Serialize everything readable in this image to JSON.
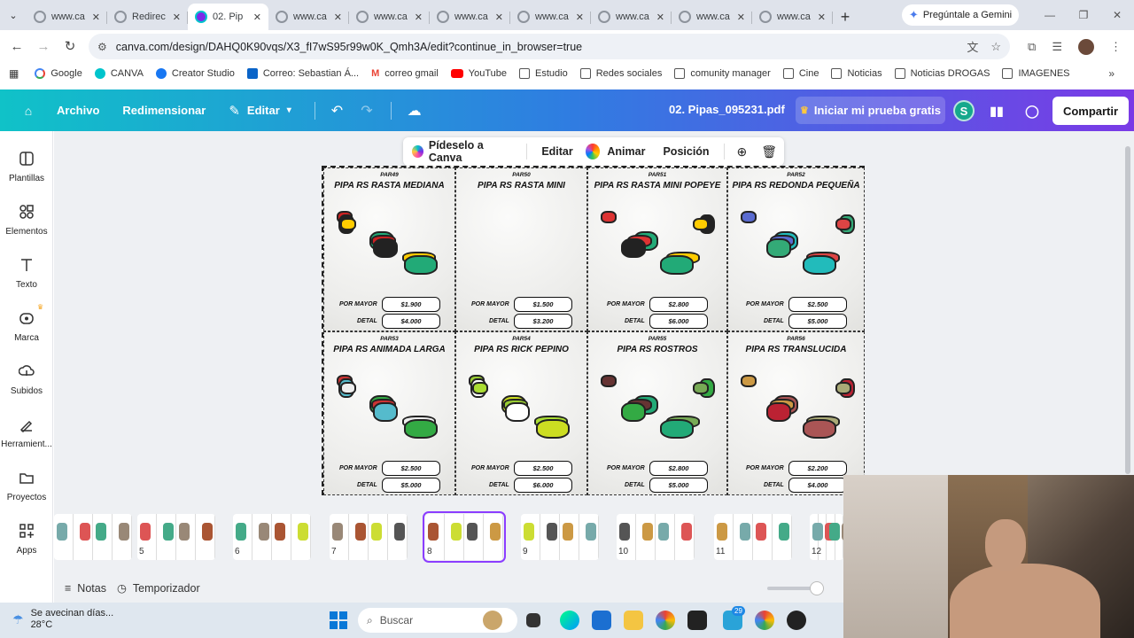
{
  "browser": {
    "tabs": [
      {
        "label": "www.ca",
        "active": false
      },
      {
        "label": "Redirec",
        "active": false
      },
      {
        "label": "02. Pip",
        "active": true
      },
      {
        "label": "www.ca",
        "active": false
      },
      {
        "label": "www.ca",
        "active": false
      },
      {
        "label": "www.ca",
        "active": false
      },
      {
        "label": "www.ca",
        "active": false
      },
      {
        "label": "www.ca",
        "active": false
      },
      {
        "label": "www.ca",
        "active": false
      },
      {
        "label": "www.ca",
        "active": false
      }
    ],
    "gemini_label": "Pregúntale a Gemini",
    "url": "canva.com/design/DAHQ0K90vqs/X3_fI7wS95r99w0K_Qmh3A/edit?continue_in_browser=true",
    "bookmarks": [
      {
        "label": "Google",
        "icon": "google-icon"
      },
      {
        "label": "CANVA",
        "icon": "canva-icon"
      },
      {
        "label": "Creator Studio",
        "icon": "facebook-icon"
      },
      {
        "label": "Correo: Sebastian Á...",
        "icon": "outlook-icon"
      },
      {
        "label": "correo gmail",
        "icon": "gmail-icon"
      },
      {
        "label": "YouTube",
        "icon": "youtube-icon"
      },
      {
        "label": "Estudio",
        "icon": "folder-icon"
      },
      {
        "label": "Redes sociales",
        "icon": "folder-icon"
      },
      {
        "label": "comunity manager",
        "icon": "folder-icon"
      },
      {
        "label": "Cine",
        "icon": "folder-icon"
      },
      {
        "label": "Noticias",
        "icon": "folder-icon"
      },
      {
        "label": "Noticias DROGAS",
        "icon": "folder-icon"
      },
      {
        "label": "IMAGENES",
        "icon": "folder-icon"
      }
    ]
  },
  "canva": {
    "menu": {
      "archivo": "Archivo",
      "redimensionar": "Redimensionar",
      "editar": "Editar"
    },
    "file_name": "02. Pipas_095231.pdf",
    "trial": "Iniciar mi prueba gratis",
    "user_initial": "S",
    "share": "Compartir",
    "sidebar": [
      {
        "label": "Plantillas",
        "icon": "templates-icon"
      },
      {
        "label": "Elementos",
        "icon": "elements-icon"
      },
      {
        "label": "Texto",
        "icon": "text-icon"
      },
      {
        "label": "Marca",
        "icon": "brand-icon"
      },
      {
        "label": "Subidos",
        "icon": "uploads-icon"
      },
      {
        "label": "Herramient...",
        "icon": "tools-icon"
      },
      {
        "label": "Proyectos",
        "icon": "projects-icon"
      },
      {
        "label": "Apps",
        "icon": "apps-icon"
      }
    ],
    "floatbar": {
      "ask": "Pídeselo a Canva",
      "edit": "Editar",
      "animate": "Animar",
      "position": "Posición"
    },
    "products": [
      {
        "code": "PAR49",
        "title": "PIPA RS RASTA MEDIANA",
        "mayor": "$1.900",
        "detal": "$4.000"
      },
      {
        "code": "PAR50",
        "title": "PIPA RS RASTA MINI",
        "mayor": "$1.500",
        "detal": "$3.200"
      },
      {
        "code": "PAR51",
        "title": "PIPA RS RASTA MINI POPEYE",
        "mayor": "$2.800",
        "detal": "$6.000"
      },
      {
        "code": "PAR52",
        "title": "PIPA RS REDONDA PEQUEÑA",
        "mayor": "$2.500",
        "detal": "$5.000"
      },
      {
        "code": "PAR53",
        "title": "PIPA RS ANIMADA LARGA",
        "mayor": "$2.500",
        "detal": "$5.000"
      },
      {
        "code": "PAR54",
        "title": "PIPA RS RICK PEPINO",
        "mayor": "$2.500",
        "detal": "$6.000"
      },
      {
        "code": "PAR55",
        "title": "PIPA RS ROSTROS",
        "mayor": "$2.800",
        "detal": "$5.000"
      },
      {
        "code": "PAR56",
        "title": "PIPA RS TRANSLUCIDA",
        "mayor": "$2.200",
        "detal": "$4.000"
      }
    ],
    "price_labels": {
      "mayor": "POR MAYOR",
      "detal": "DETAL"
    },
    "pages": [
      "",
      "5",
      "6",
      "7",
      "8",
      "9",
      "10",
      "11",
      "12"
    ],
    "selected_page": "8",
    "bottom": {
      "notes": "Notas",
      "timer": "Temporizador"
    }
  },
  "taskbar": {
    "weather_text": "Se avecinan días...",
    "temperature": "28°C",
    "search": "Buscar",
    "badge": "29"
  },
  "colors": {
    "accent": "#8b3dff",
    "canva_teal": "#10c2c8",
    "canva_purple": "#7a3ae6"
  }
}
